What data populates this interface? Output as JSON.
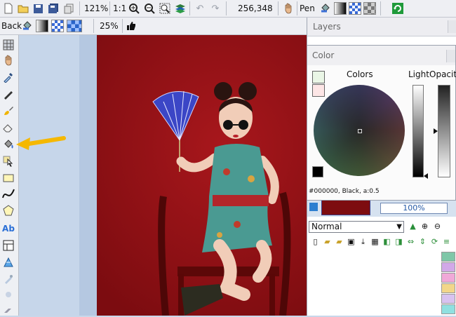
{
  "toolbar": {
    "zoom_value": "121%",
    "actual_size": "1:1",
    "coordinates": "256,348",
    "tool_name": "Pen"
  },
  "toolbar2": {
    "back_label": "Back",
    "zoom_value": "25%"
  },
  "layers_panel": {
    "title": "Layers",
    "layer_opacity": "100%",
    "blend_mode": "Normal"
  },
  "color_window": {
    "title": "Color",
    "colors_label": "Colors",
    "light_label": "Light",
    "opacity_label": "Opacity",
    "color_readout": "#000000, Black, a:0.5",
    "current_color": "#000000"
  },
  "palette_colors": [
    "#7fc7a8",
    "#d2a8e8",
    "#f0a8d8",
    "#f2d68a",
    "#d8c2f0",
    "#8fe0e0"
  ],
  "icons": {
    "new": "new-file-icon",
    "open": "open-folder-icon",
    "save": "save-icon",
    "save_all": "save-all-icon",
    "copy": "copy-icon",
    "zoom_in": "zoom-in-icon",
    "zoom_out": "zoom-out-icon",
    "zoom_fit": "zoom-fit-icon",
    "layers": "layers-icon",
    "undo": "undo-icon",
    "redo": "redo-icon",
    "hand": "hand-icon",
    "thumbs_up": "thumbs-up-icon"
  },
  "annotation": {
    "arrow_color": "#f5b800"
  }
}
